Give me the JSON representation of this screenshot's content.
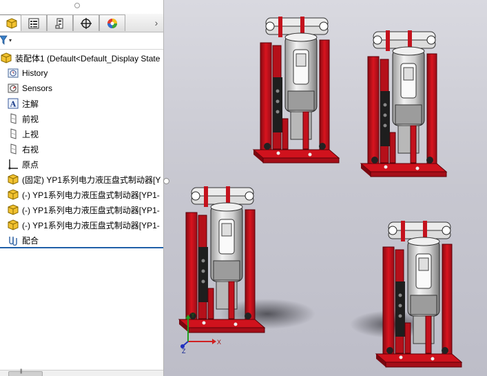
{
  "feature_manager": {
    "tabs": [
      {
        "name": "featuremanager-tab",
        "icon": "assembly-cube-icon",
        "active": true
      },
      {
        "name": "propertymanager-tab",
        "icon": "property-list-icon",
        "active": false
      },
      {
        "name": "configurationmanager-tab",
        "icon": "configuration-icon",
        "active": false
      },
      {
        "name": "dimxpert-tab",
        "icon": "crosshair-icon",
        "active": false
      },
      {
        "name": "display-manager-tab",
        "icon": "color-wheel-icon",
        "active": false
      }
    ],
    "tab_overflow_glyph": "›",
    "filter_glyph": "▾",
    "tree": {
      "root": "装配体1  (Default<Default_Display State",
      "items": [
        {
          "label": "History",
          "icon": "history-icon"
        },
        {
          "label": "Sensors",
          "icon": "sensors-icon"
        },
        {
          "label": "注解",
          "icon": "annotations-icon"
        },
        {
          "label": "前视",
          "icon": "plane-icon"
        },
        {
          "label": "上视",
          "icon": "plane-icon"
        },
        {
          "label": "右视",
          "icon": "plane-icon"
        },
        {
          "label": "原点",
          "icon": "origin-icon"
        },
        {
          "label": "(固定) YP1系列电力液压盘式制动器[Y",
          "icon": "part-icon"
        },
        {
          "label": "(-) YP1系列电力液压盘式制动器[YP1-",
          "icon": "part-icon"
        },
        {
          "label": "(-) YP1系列电力液压盘式制动器[YP1-",
          "icon": "part-icon"
        },
        {
          "label": "(-) YP1系列电力液压盘式制动器[YP1-",
          "icon": "part-icon"
        },
        {
          "label": "配合",
          "icon": "mates-icon"
        }
      ]
    },
    "scroll_glyph": "|||"
  },
  "viewport": {
    "triad_labels": {
      "x": "X",
      "y": "Y",
      "z": "Z"
    },
    "colors": {
      "frame": "#c4121d",
      "motor": "#d8d8d8",
      "dark": "#1a1a1a",
      "axis_x": "#d02020",
      "axis_y": "#20a020",
      "axis_z": "#2030c0"
    }
  }
}
